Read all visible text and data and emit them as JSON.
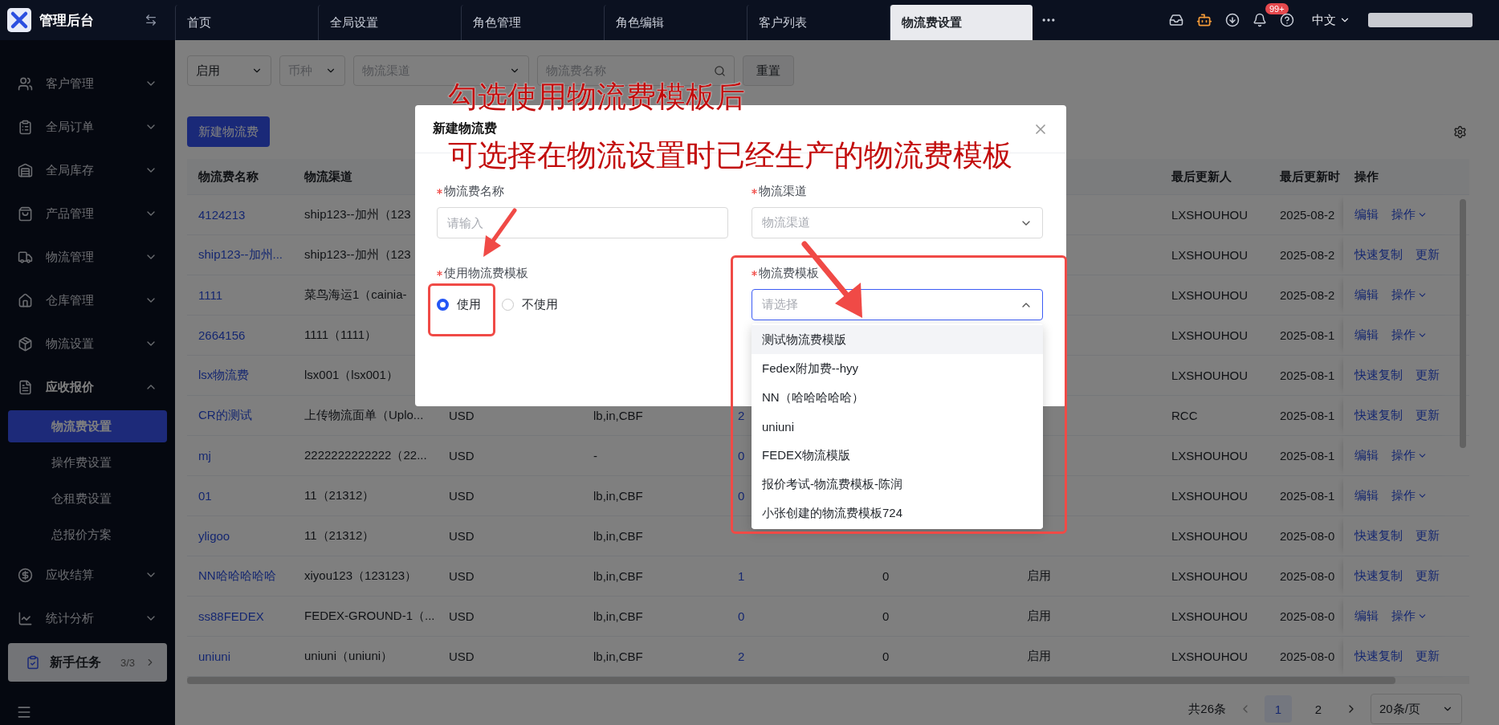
{
  "app": {
    "title": "管理后台"
  },
  "tabs": [
    {
      "label": "首页",
      "selected": false
    },
    {
      "label": "全局设置",
      "selected": false
    },
    {
      "label": "角色管理",
      "selected": false
    },
    {
      "label": "角色编辑",
      "selected": false
    },
    {
      "label": "客户列表",
      "selected": false
    },
    {
      "label": "物流费设置",
      "selected": true
    }
  ],
  "header": {
    "notification_badge": "99+",
    "language": "中文"
  },
  "sidebar": {
    "items": [
      {
        "label": "客户管理",
        "expanded": false
      },
      {
        "label": "全局订单",
        "expanded": false
      },
      {
        "label": "全局库存",
        "expanded": false
      },
      {
        "label": "产品管理",
        "expanded": false
      },
      {
        "label": "物流管理",
        "expanded": false
      },
      {
        "label": "仓库管理",
        "expanded": false
      },
      {
        "label": "物流设置",
        "expanded": false
      },
      {
        "label": "应收报价",
        "expanded": true,
        "children": [
          {
            "label": "物流费设置",
            "selected": true
          },
          {
            "label": "操作费设置",
            "selected": false
          },
          {
            "label": "仓租费设置",
            "selected": false
          },
          {
            "label": "总报价方案",
            "selected": false
          }
        ]
      },
      {
        "label": "应收结算",
        "expanded": false
      },
      {
        "label": "统计分析",
        "expanded": false
      }
    ],
    "task_card": {
      "label": "新手任务",
      "count": "3/3"
    }
  },
  "filters": {
    "status": {
      "value": "启用"
    },
    "currency": {
      "placeholder": "币种"
    },
    "channel": {
      "placeholder": "物流渠道"
    },
    "name_search": {
      "placeholder": "物流费名称"
    },
    "reset_button": "重置"
  },
  "new_button": "新建物流费",
  "table": {
    "columns": [
      "物流费名称",
      "物流渠道",
      "最后更新人",
      "最后更新时",
      "操作"
    ],
    "rows": [
      {
        "name": "4124213",
        "channel": "ship123--加州（123",
        "updater": "LXSHOUHOU",
        "updated": "2025-08-2",
        "actions": [
          {
            "label": "编辑",
            "menu": false
          },
          {
            "label": "操作",
            "menu": true
          }
        ]
      },
      {
        "name": "ship123--加州...",
        "channel": "ship123--加州（123",
        "updater": "LXSHOUHOU",
        "updated": "2025-08-2",
        "actions": [
          {
            "label": "快速复制",
            "menu": false
          },
          {
            "label": "更新",
            "menu": false
          }
        ]
      },
      {
        "name": "1111",
        "channel": "菜鸟海运1（cainia-",
        "updater": "LXSHOUHOU",
        "updated": "2025-08-2",
        "actions": [
          {
            "label": "编辑",
            "menu": false
          },
          {
            "label": "操作",
            "menu": true
          }
        ]
      },
      {
        "name": "2664156",
        "channel": "1111（1111）",
        "updater": "LXSHOUHOU",
        "updated": "2025-08-1",
        "actions": [
          {
            "label": "编辑",
            "menu": false
          },
          {
            "label": "操作",
            "menu": true
          }
        ]
      },
      {
        "name": "lsx物流费",
        "channel": "lsx001（lsx001）",
        "updater": "LXSHOUHOU",
        "updated": "2025-08-1",
        "actions": [
          {
            "label": "快速复制",
            "menu": false
          },
          {
            "label": "更新",
            "menu": false
          }
        ]
      },
      {
        "name": "CR的测试",
        "channel": "上传物流面单（Uplo...",
        "column_3": "USD",
        "column_4": "lb,in,CBF",
        "column_5": "2",
        "updater": "RCC",
        "updated": "2025-08-1",
        "actions": [
          {
            "label": "快速复制",
            "menu": false
          },
          {
            "label": "更新",
            "menu": false
          }
        ]
      },
      {
        "name": "mj",
        "channel": "2222222222222（22...",
        "column_3": "USD",
        "column_4": "-",
        "column_5": "0",
        "updater": "LXSHOUHOU",
        "updated": "2025-08-1",
        "actions": [
          {
            "label": "编辑",
            "menu": false
          },
          {
            "label": "操作",
            "menu": true
          }
        ]
      },
      {
        "name": "01",
        "channel": "11（21312）",
        "column_3": "USD",
        "column_4": "lb,in,CBF",
        "column_5": "0",
        "updater": "LXSHOUHOU",
        "updated": "2025-08-1",
        "actions": [
          {
            "label": "编辑",
            "menu": false
          },
          {
            "label": "操作",
            "menu": true
          }
        ]
      },
      {
        "name": "yligoo",
        "channel": "11（21312）",
        "column_3": "USD",
        "column_4": "lb,in,CBF",
        "updater": "LXSHOUHOU",
        "updated": "2025-08-0",
        "actions": [
          {
            "label": "快速复制",
            "menu": false
          },
          {
            "label": "更新",
            "menu": false
          }
        ]
      },
      {
        "name": "NN哈哈哈哈哈",
        "channel": "xiyou123（123123）",
        "column_3": "USD",
        "column_4": "lb,in,CBF",
        "column_5": "1",
        "column_6": "0",
        "column_7": "启用",
        "updater": "LXSHOUHOU",
        "updated": "2025-08-0",
        "actions": [
          {
            "label": "快速复制",
            "menu": false
          },
          {
            "label": "更新",
            "menu": false
          }
        ]
      },
      {
        "name": "ss88FEDEX",
        "channel": "FEDEX-GROUND-1（...",
        "column_3": "USD",
        "column_4": "lb,in,CBF",
        "column_5": "0",
        "column_6": "0",
        "column_7": "启用",
        "updater": "LXSHOUHOU",
        "updated": "2025-08-0",
        "actions": [
          {
            "label": "编辑",
            "menu": false
          },
          {
            "label": "操作",
            "menu": true
          }
        ]
      },
      {
        "name": "uniuni",
        "channel": "uniuni（uniuni）",
        "column_3": "USD",
        "column_4": "lb,in,CBF",
        "column_5": "2",
        "column_6": "0",
        "column_7": "启用",
        "updater": "LXSHOUHOU",
        "updated": "2025-08-0",
        "actions": [
          {
            "label": "快速复制",
            "menu": false
          },
          {
            "label": "更新",
            "menu": false
          }
        ]
      }
    ]
  },
  "pagination": {
    "total": "共26条",
    "pages": [
      {
        "label": "1",
        "selected": true
      },
      {
        "label": "2",
        "selected": false
      }
    ],
    "page_size": "20条/页"
  },
  "modal": {
    "title": "新建物流费",
    "fields": [
      {
        "kind": "input",
        "label": "物流费名称",
        "required": true,
        "placeholder": "请输入"
      },
      {
        "kind": "select",
        "label": "物流渠道",
        "required": true,
        "placeholder": "物流渠道",
        "open": false
      },
      {
        "kind": "radio",
        "label": "使用物流费模板",
        "required": true,
        "options": [
          {
            "label": "使用",
            "selected": true
          },
          {
            "label": "不使用",
            "selected": false
          }
        ]
      },
      {
        "kind": "select",
        "label": "物流费模板",
        "required": true,
        "placeholder": "请选择",
        "open": true,
        "options": [
          {
            "label": "测试物流费模版",
            "active": true
          },
          {
            "label": "Fedex附加费--hyy",
            "active": false
          },
          {
            "label": "NN（哈哈哈哈哈）",
            "active": false
          },
          {
            "label": "uniuni",
            "active": false
          },
          {
            "label": "FEDEX物流模版",
            "active": false
          },
          {
            "label": "报价考试-物流费模板-陈润",
            "active": false
          },
          {
            "label": "小张创建的物流费模板724",
            "active": false
          }
        ]
      }
    ]
  },
  "annotation": {
    "lines": [
      "勾选使用物流费模板后",
      "可选择在物流设置时已经生产的物流费模板"
    ]
  }
}
